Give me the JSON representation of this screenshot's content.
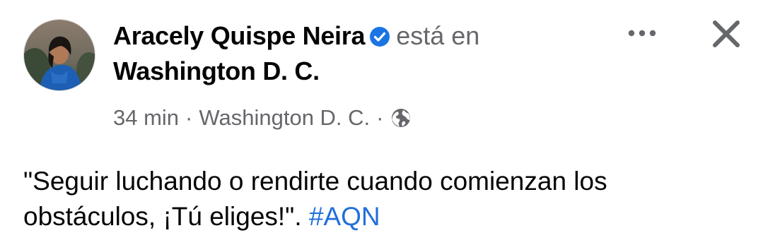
{
  "post": {
    "author": {
      "name": "Aracely Quispe Neira",
      "verified": true,
      "avatar_icon": "avatar-photo"
    },
    "checkin": {
      "prefix": "está en",
      "place": "Washington D. C."
    },
    "meta": {
      "time": "34 min",
      "separator": "·",
      "location": "Washington D. C.",
      "audience_icon": "globe-icon"
    },
    "body": {
      "text": "\"Seguir luchando o rendirte cuando comienzan los obstáculos, ¡Tú eliges!\".",
      "hashtag": "#AQN"
    },
    "actions": {
      "more_icon": "more-horizontal-icon",
      "close_icon": "close-icon"
    }
  },
  "colors": {
    "text_primary": "#050505",
    "text_secondary": "#65676b",
    "link": "#216fdb",
    "verified_badge": "#1b74e4",
    "icon_gray": "#65676b"
  }
}
